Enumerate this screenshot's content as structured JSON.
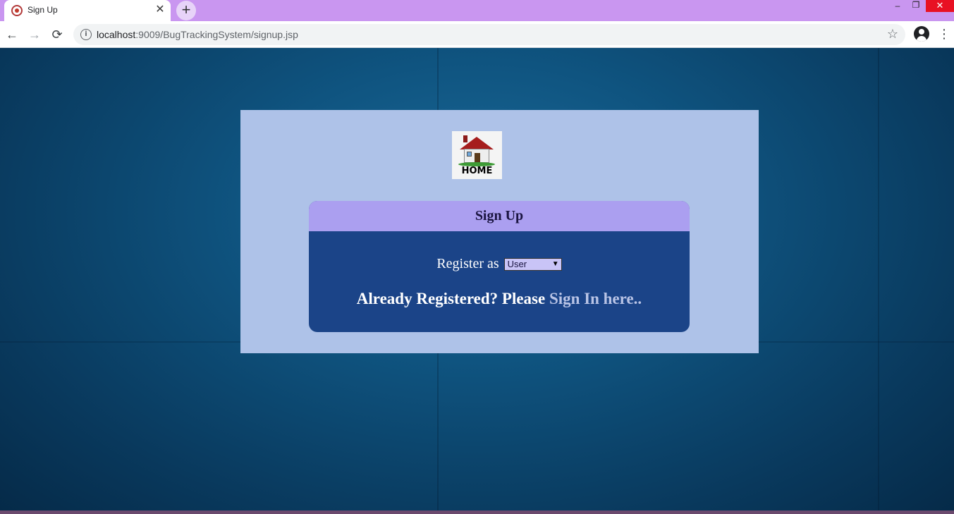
{
  "browser": {
    "tab_title": "Sign Up",
    "tab_close": "✕",
    "new_tab": "+",
    "url_host": "localhost",
    "url_rest": ":9009/BugTrackingSystem/signup.jsp",
    "window_minimize": "–",
    "window_restore": "❐",
    "window_close": "✕",
    "back": "←",
    "forward": "→",
    "reload": "⟳",
    "info": "i",
    "star": "☆",
    "menu": "⋮"
  },
  "page": {
    "home_label": "HOME",
    "signup_title": "Sign Up",
    "register_label": "Register as",
    "register_select_value": "User",
    "already_text": "Already Registered? Please",
    "signin_link": "Sign In here.."
  },
  "colors": {
    "tabbar": "#c996f0",
    "panel": "#aec2e8",
    "signup_header": "#ab9ff0",
    "signup_body": "#1b4488"
  }
}
